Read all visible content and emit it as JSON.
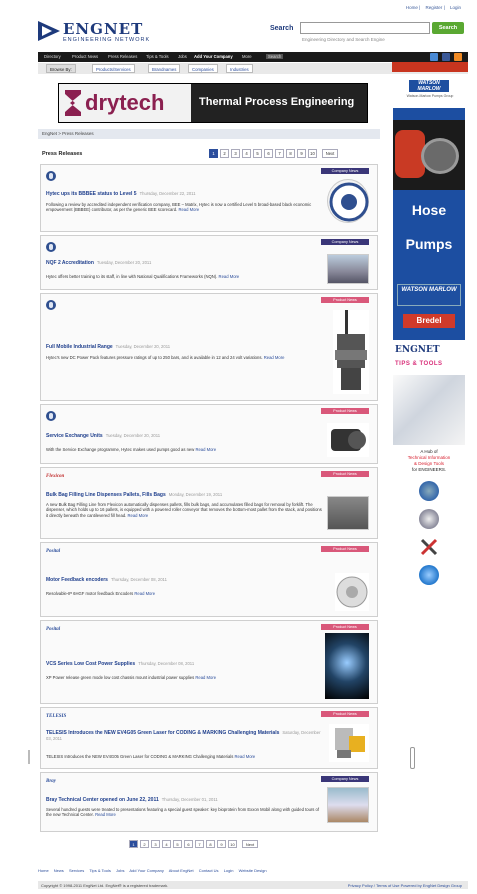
{
  "top_links": [
    "Home",
    "Register",
    "Login"
  ],
  "logo": {
    "word": "ENGNET",
    "sub": "ENGINEERING NETWORK"
  },
  "search": {
    "label": "Search",
    "button": "Search",
    "placeholder": "",
    "hint": "Engineering Directory and Search Engine"
  },
  "nav": {
    "items": [
      "Directory",
      "Product News",
      "Press Releases",
      "Tips & Tools",
      "Jobs"
    ],
    "add": "Add Your Company",
    "more": "More",
    "search_box": "Search"
  },
  "browse": {
    "label": "Browse By:",
    "tabs": [
      "Products/Services",
      "Brandnames",
      "Companies",
      "Industries"
    ]
  },
  "right_promo": "",
  "banner": {
    "brand": "drytech",
    "tagline": "Thermal Process Engineering"
  },
  "breadcrumb": "EngNet > Press Releases",
  "section_title": "Press Releases",
  "pager": {
    "pages": [
      "1",
      "2",
      "3",
      "4",
      "5",
      "6",
      "7",
      "8",
      "9",
      "10"
    ],
    "next": "Next",
    "active": "1"
  },
  "releases": [
    {
      "badge": "Company News",
      "badge_type": "company",
      "title": "Hytec ups its BBBEE status to Level 5",
      "date": "Thursday, December 22, 2011",
      "body": "Following a review by accredited independent verification company, BEE – Matrix, Hytec is now a certified Level 5 broad-based black economic empowerment (BBBEE) contributor, as per the generic BEE scorecard.",
      "more": "Read More"
    },
    {
      "badge": "Company News",
      "badge_type": "company",
      "title": "NQF 2 Accreditation",
      "date": "Tuesday, December 20, 2011",
      "body": "Hytec offers better training to its staff, in line with National Qualifications Frameworks (NQN).",
      "more": "Read More"
    },
    {
      "badge": "Product News",
      "badge_type": "product",
      "title": "Full Mobile Industrial Range",
      "date": "Tuesday, December 20, 2011",
      "body": "Hytec's new DC Power Pack features pressure ratings of up to 250 bars, and is available in 12 and 24 volt variations.",
      "more": "Read More"
    },
    {
      "badge": "Product News",
      "badge_type": "product",
      "title": "Service Exchange Units",
      "date": "Tuesday, December 20, 2011",
      "body": "With the Service Exchange programme, Hytec makes used pumps good as new",
      "more": "Read More"
    },
    {
      "logo": "Flexicon",
      "badge": "Product News",
      "badge_type": "product",
      "title": "Bulk Bag Filling Line Dispenses Pallets, Fills Bags",
      "date": "Monday, December 19, 2011",
      "body": "A new Bulk Bag Filling Line from Flexicon automatically dispenses pallets, fills bulk bags, and accumulates filled bags for removal by forklift. The dispenser, which holds up to 16 pallets, is equipped with a powered roller conveyor that removes the bottom-most pallet from the stack, and positions it directly beneath the cantilevered fill head.",
      "more": "Read More"
    },
    {
      "logo": "Posital",
      "badge": "Product News",
      "badge_type": "product",
      "title": "Motor Feedback encoders",
      "date": "Thursday, December 08, 2011",
      "body": "Resolvable-IP 6HGF motor feedback Encoders",
      "more": "Read More"
    },
    {
      "logo": "Posital",
      "badge": "Product News",
      "badge_type": "product",
      "title": "VCS Series Low Cost Power Supplies",
      "date": "Thursday, December 08, 2011",
      "body": "XP Power release green mode low cost chassis mount industrial power supplies",
      "more": "Read More"
    },
    {
      "logo": "TELESIS",
      "badge": "Product News",
      "badge_type": "product",
      "title": "TELESIS Introduces the NEW EV4G05 Green Laser for CODING & MARKING Challenging Materials",
      "date": "Saturday, December 03, 2011",
      "body": "TELESIS Introduces the NEW EV4G05 Green Laser for CODING & MARKING Challenging Materials",
      "more": "Read More"
    },
    {
      "logo": "Bray",
      "badge": "Company News",
      "badge_type": "company",
      "title": "Bray Technical Center opened on June 22, 2011",
      "date": "Thursday, December 01, 2011",
      "body": "Several hundred guests were treated to presentations featuring a special guest speaker: key bioprotein from Exxon Mobil along with guided tours of the new Technical Center.",
      "more": "Read More"
    }
  ],
  "side": {
    "watson_top": "WATSON MARLOW",
    "watson_sub": "Watson-Marlow Pumps Group",
    "hose": "Hose",
    "pumps": "Pumps",
    "watson_logo": "WATSON MARLOW",
    "bredel": "Bredel",
    "engnet": "ENGNET",
    "tips": "TIPS & TOOLS",
    "hub_a": "A Hub of",
    "hub_b": "Technical Information",
    "hub_c": "& Design Tools",
    "hub_d": "for ENGINEERS."
  },
  "footer": {
    "links": [
      "Home",
      "News",
      "Services",
      "Tips & Tools",
      "Jobs",
      "Add Your Company",
      "About EngNet",
      "Contact Us",
      "Login",
      "Website Design"
    ],
    "copy": "Copyright © 1998-2011 EngNet Ltd.  EngNet® is a registered trademark.",
    "copy_right": "Privacy Policy / Terms of Use   Powered by EngNet Design Group"
  },
  "colors": {
    "brand": "#1e3a7c",
    "search_green": "#5aa832",
    "company_badge": "#3a3678",
    "product_badge": "#d9587a",
    "pager_active": "#2c4e9c",
    "side_blue": "#1c4ea1"
  }
}
